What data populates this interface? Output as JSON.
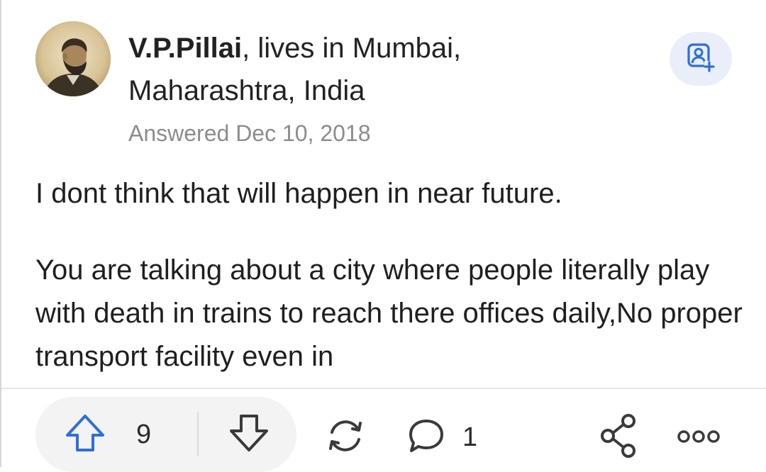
{
  "answer": {
    "author": {
      "name": "V.P.Pillai",
      "credential": ", lives in Mumbai,",
      "credential_line2": "Maharashtra, India"
    },
    "answered_date": "Answered Dec 10, 2018",
    "paragraphs": [
      "I dont think that will happen in near future.",
      "You are talking about a city where people literally play with death in trains to reach there offices daily,No proper transport facility even in"
    ]
  },
  "actions": {
    "upvote_count": "9",
    "comment_count": "1"
  },
  "icons": {
    "follow": "person-add-icon",
    "upvote": "arrow-up-icon",
    "downvote": "arrow-down-icon",
    "reshare": "refresh-cycle-icon",
    "comment": "speech-bubble-icon",
    "share": "share-icon",
    "more": "more-dots-icon"
  },
  "colors": {
    "accent": "#2f6fd6",
    "muted_text": "#8c8c8c",
    "follow_bg": "#e9eef9",
    "pill_bg": "#f3f3f4"
  }
}
